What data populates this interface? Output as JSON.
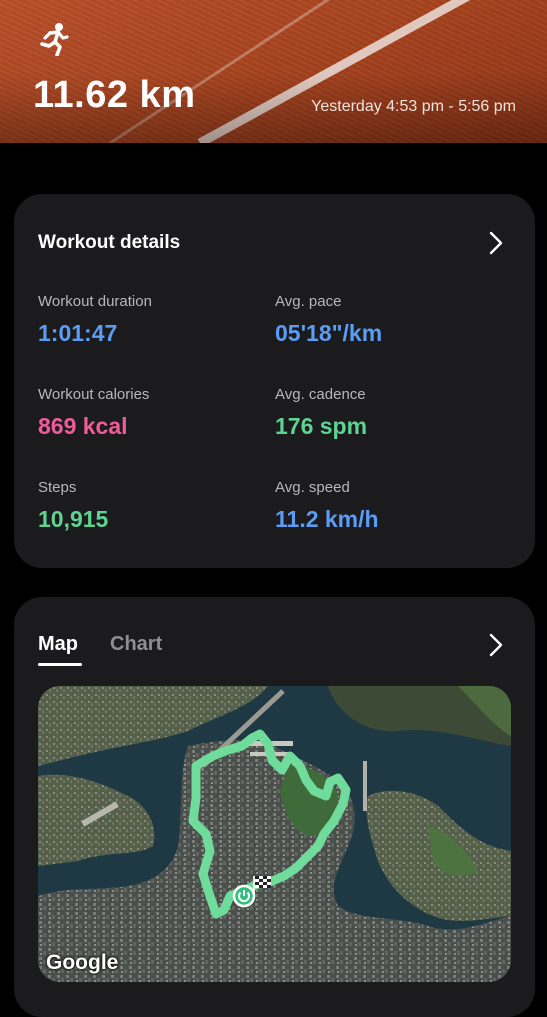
{
  "header": {
    "activity_icon": "running-person-icon",
    "distance": "11.62 km",
    "time_range": "Yesterday 4:53 pm - 5:56 pm"
  },
  "details": {
    "title": "Workout details",
    "chevron_icon": "chevron-right-icon",
    "metrics": [
      {
        "label": "Workout duration",
        "value": "1:01:47",
        "color": "#5b9cf5"
      },
      {
        "label": "Avg. pace",
        "value": "05'18\"/km",
        "color": "#5b9cf5"
      },
      {
        "label": "Workout calories",
        "value": "869 kcal",
        "color": "#ef5b9b"
      },
      {
        "label": "Avg. cadence",
        "value": "176 spm",
        "color": "#5fd393"
      },
      {
        "label": "Steps",
        "value": "10,915",
        "color": "#5fd393"
      },
      {
        "label": "Avg. speed",
        "value": "11.2 km/h",
        "color": "#5b9cf5"
      }
    ]
  },
  "map_card": {
    "tabs": [
      {
        "label": "Map",
        "active": true
      },
      {
        "label": "Chart",
        "active": false
      }
    ],
    "chevron_icon": "chevron-right-icon",
    "map_attribution": "Google",
    "route_color": "#6fdc9c",
    "start_icon": "start-marker-icon",
    "finish_icon": "finish-flag-icon"
  }
}
